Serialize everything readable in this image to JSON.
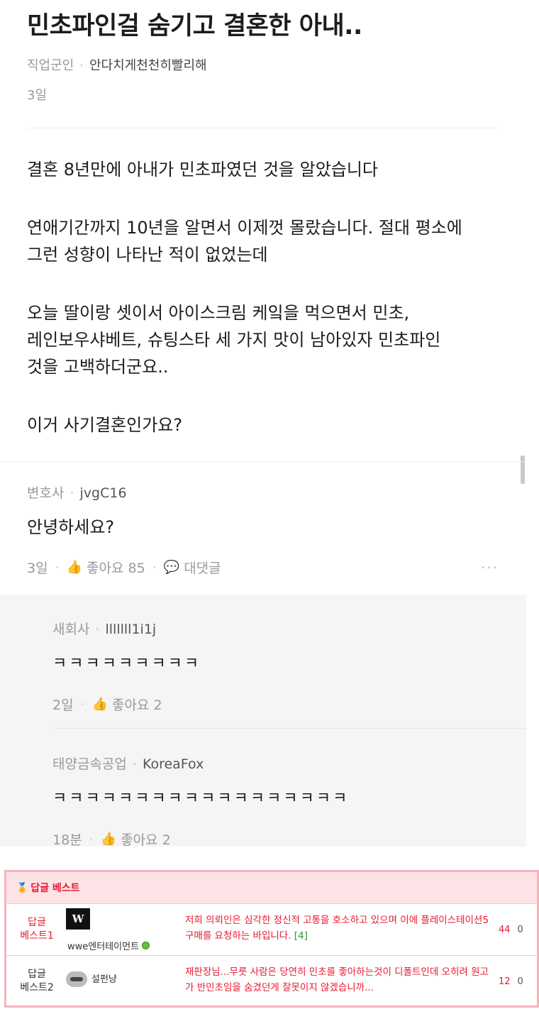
{
  "post": {
    "title": "민초파인걸 숨기고 결혼한 아내..",
    "author_job": "직업군인",
    "author_name": "안다치게천천히빨리해",
    "date": "3일",
    "paragraphs": [
      [
        "결혼 8년만에 아내가 민초파였던 것을 알았습니다"
      ],
      [
        "연애기간까지 10년을 알면서 이제껏 몰랐습니다. 절대 평소에",
        "그런 성향이 나타난 적이 없었는데"
      ],
      [
        "오늘 딸이랑 셋이서 아이스크림 케잌을 먹으면서 민초,",
        "레인보우샤베트, 슈팅스타 세 가지 맛이 남아있자 민초파인",
        "것을 고백하더군요.."
      ],
      [
        "이거 사기결혼인가요?"
      ]
    ]
  },
  "comment": {
    "author_job": "변호사",
    "author_name": "jvgC16",
    "text": "안녕하세요?",
    "date": "3일",
    "like_label": "좋아요 85",
    "reply_label": "대댓글",
    "more": "..."
  },
  "replies": [
    {
      "author_job": "새회사",
      "author_name": "lllllll1i1j",
      "text": "ㅋㅋㅋㅋㅋㅋㅋㅋㅋ",
      "date": "2일",
      "like_label": "좋아요 2"
    },
    {
      "author_job": "태양금속공업",
      "author_name": "KoreaFox",
      "text": "ㅋㅋㅋㅋㅋㅋㅋㅋㅋㅋㅋㅋㅋㅋㅋㅋㅋㅋ",
      "date": "18분",
      "like_label": "좋아요 2"
    }
  ],
  "best": {
    "header": "답글 베스트",
    "rows": [
      {
        "rank_line1": "답글",
        "rank_line2": "베스트1",
        "user_img": "W",
        "user_name": "wwe엔터테이먼트",
        "text": "저희 의뢰인은 심각한 정신적 고통을 호소하고 있으며 이에 플레이스테이션5 구매를 요청하는 바입니다.",
        "reply_count": "[4]",
        "up": "44",
        "down": "0"
      },
      {
        "rank_line1": "답글",
        "rank_line2": "베스트2",
        "user_name": "설펀냥",
        "text": "재판장님...무릇 사람은 당연히 민초를 좋아하는것이 디폴트인데 오히려 원고가 반민초임을 숨겼던게 잘못이지 않겠습니까...",
        "up": "12",
        "down": "0"
      }
    ]
  },
  "colors": {
    "best_accent": "#e8192e",
    "best_border": "#f3b4bb",
    "best_header_bg": "#fde3e6",
    "reply_bg": "#f5f5f5"
  },
  "icons": {
    "like": "thumbs-up-icon",
    "reply": "speech-bubble-icon",
    "medal": "medal-icon",
    "online": "online-status-icon"
  }
}
